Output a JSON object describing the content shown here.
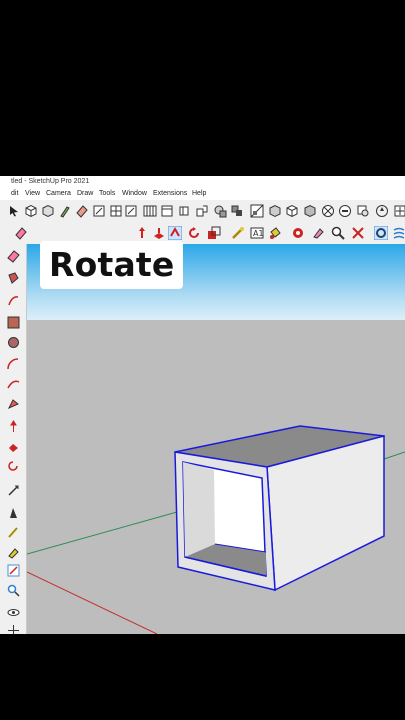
{
  "window": {
    "title": "tled - SketchUp Pro 2021"
  },
  "menu": [
    "dit",
    "View",
    "Camera",
    "Draw",
    "Tools",
    "Window",
    "Extensions",
    "Help"
  ],
  "overlay": {
    "label": "Rotate"
  },
  "colors": {
    "sky_top": "#2ba7e8",
    "ground": "#bdbdbd",
    "selection": "#1a1adb",
    "axis_red": "#c53030",
    "axis_green": "#2e8b57"
  }
}
